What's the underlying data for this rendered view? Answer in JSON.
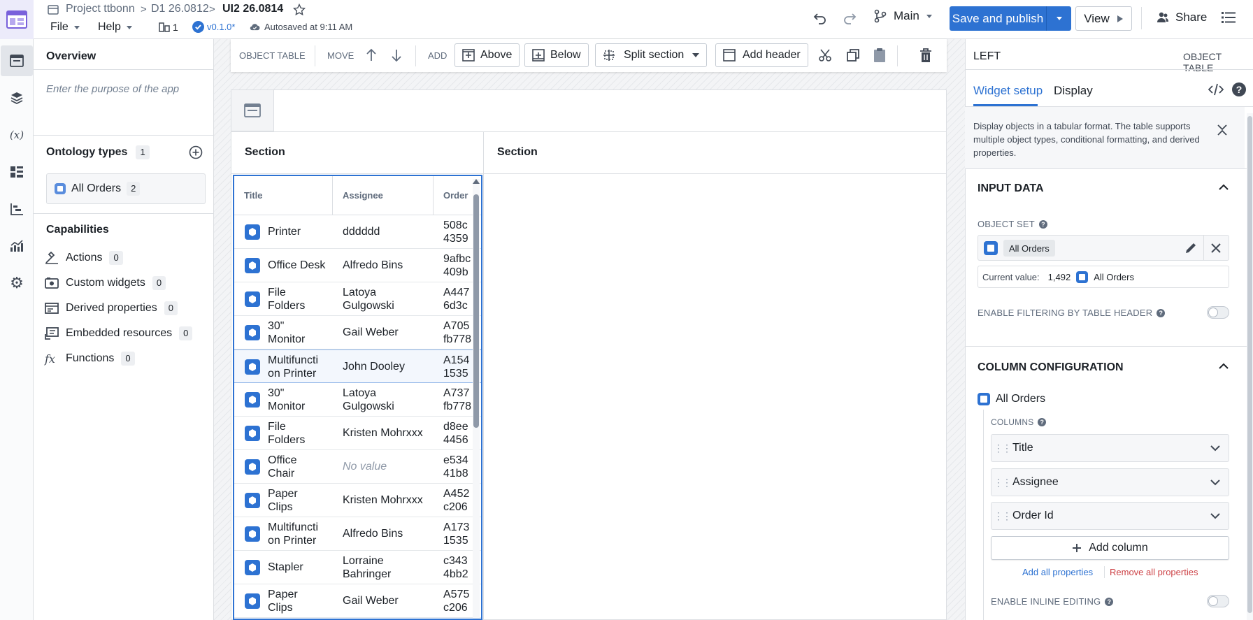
{
  "header": {
    "breadcrumbs": [
      "Project ttbonn",
      "D1 26.0812",
      "UI2 26.0814"
    ],
    "menus": [
      "File",
      "Help"
    ],
    "page_count": "1",
    "version": "v0.1.0*",
    "autosave": "Autosaved at 9:11 AM",
    "branch": "Main",
    "publish_label": "Save and publish",
    "view_label": "View",
    "share_label": "Share"
  },
  "left_panel": {
    "overview_title": "Overview",
    "purpose_placeholder": "Enter the purpose of the app",
    "ontology_title": "Ontology types",
    "ontology_count": "1",
    "ontology_items": [
      {
        "label": "All Orders",
        "count": "2"
      }
    ],
    "capabilities_title": "Capabilities",
    "capabilities": [
      {
        "label": "Actions",
        "count": "0",
        "icon": "actions-icon"
      },
      {
        "label": "Custom widgets",
        "count": "0",
        "icon": "custom-widget-icon"
      },
      {
        "label": "Derived properties",
        "count": "0",
        "icon": "derived-properties-icon"
      },
      {
        "label": "Embedded resources",
        "count": "0",
        "icon": "embedded-resources-icon"
      },
      {
        "label": "Functions",
        "count": "0",
        "icon": "functions-icon"
      }
    ]
  },
  "widget_toolbar": {
    "object_table": "OBJECT TABLE",
    "move": "MOVE",
    "add": "ADD",
    "above": "Above",
    "below": "Below",
    "split_section": "Split section",
    "add_header": "Add header"
  },
  "canvas": {
    "sections": [
      "Section",
      "Section"
    ]
  },
  "table": {
    "columns": [
      "Title",
      "Assignee",
      "Order"
    ],
    "rows": [
      {
        "title": "Printer",
        "assignee": "dddddd",
        "order": "508c\n4359"
      },
      {
        "title": "Office Desk",
        "assignee": "Alfredo Bins",
        "order": "9afbc\n409b"
      },
      {
        "title": "File\nFolders",
        "assignee": "Latoya\nGulgowski",
        "order": "A447\n6d3c"
      },
      {
        "title": "30\"\nMonitor",
        "assignee": "Gail Weber",
        "order": "A705\nfb778"
      },
      {
        "title": "Multifuncti\non Printer",
        "assignee": "John Dooley",
        "order": "A154\n1535"
      },
      {
        "title": "30\"\nMonitor",
        "assignee": "Latoya\nGulgowski",
        "order": "A737\nfb778"
      },
      {
        "title": "File\nFolders",
        "assignee": "Kristen Mohrxxx",
        "order": "d8ee\n4456"
      },
      {
        "title": "Office\nChair",
        "assignee": "No value",
        "order": "e534\n41b8"
      },
      {
        "title": "Paper\nClips",
        "assignee": "Kristen Mohrxxx",
        "order": "A452\nc206"
      },
      {
        "title": "Multifuncti\non Printer",
        "assignee": "Alfredo Bins",
        "order": "A173\n1535"
      },
      {
        "title": "Stapler",
        "assignee": "Lorraine\nBahringer",
        "order": "c343\n4bb2"
      },
      {
        "title": "Paper\nClips",
        "assignee": "Gail Weber",
        "order": "A575\nc206"
      }
    ]
  },
  "right_panel": {
    "position": "LEFT",
    "widget_type": "OBJECT TABLE",
    "tabs": [
      "Widget setup",
      "Display"
    ],
    "description": "Display objects in a tabular format. The table supports multiple object types, conditional formatting, and derived properties.",
    "input_data_title": "INPUT DATA",
    "object_set_label": "OBJECT SET",
    "object_set_value": "All Orders",
    "current_value_label": "Current value:",
    "current_value_count": "1,492",
    "current_value_name": "All Orders",
    "filter_label": "ENABLE FILTERING BY TABLE HEADER",
    "column_config_title": "COLUMN CONFIGURATION",
    "object_type": "All Orders",
    "columns_label": "COLUMNS",
    "columns": [
      "Title",
      "Assignee",
      "Order Id"
    ],
    "add_column": "Add column",
    "add_all": "Add all properties",
    "remove_all": "Remove all properties",
    "inline_edit_label": "ENABLE INLINE EDITING"
  },
  "colors": {
    "accent": "#2d72d2",
    "danger": "#cd4246",
    "selected_row": "#f3f7fd"
  }
}
